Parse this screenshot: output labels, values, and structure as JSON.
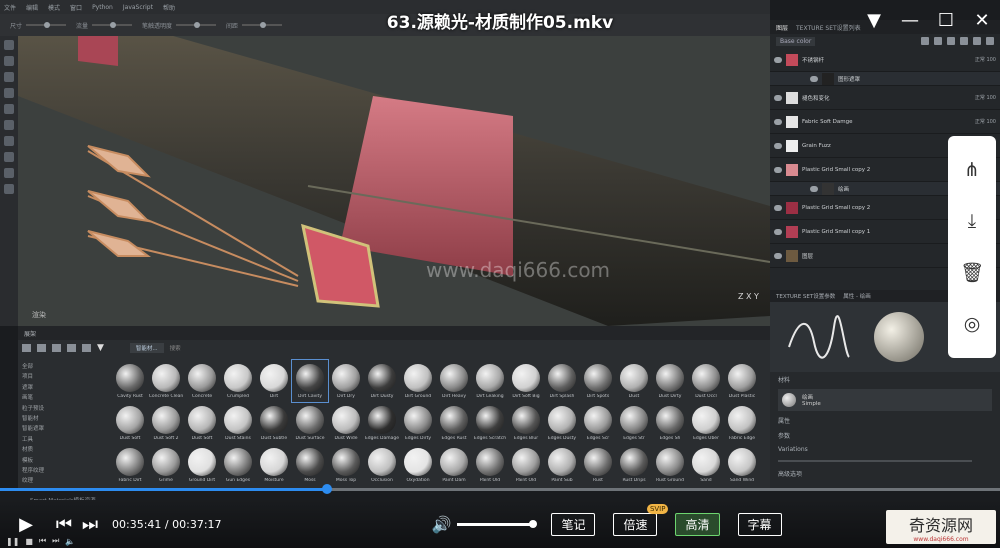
{
  "video": {
    "title": "63.源赖光-材质制作05.mkv",
    "current_time": "00:35:41",
    "time_separator": "/",
    "total_time": "00:37:17",
    "progress_fraction": 0.957,
    "volume_fraction": 1.0
  },
  "player": {
    "notes_label": "笔记",
    "speed_label": "倍速",
    "svip_badge": "SVIP",
    "quality_label": "高清",
    "subtitle_label": "字幕"
  },
  "brand": {
    "name": "奇资源网",
    "url": "www.daqi666.com"
  },
  "watermark": "www.daqi666.com",
  "app": {
    "menu": [
      "文件",
      "编辑",
      "模式",
      "窗口",
      "Python",
      "JavaScript",
      "帮助"
    ],
    "tool_labels": [
      "尺寸",
      "流量",
      "笔触透明度",
      "间距"
    ]
  },
  "viewport": {
    "label": "渲染",
    "axis": "Z X Y"
  },
  "layers": {
    "tabs": [
      "图层",
      "TEXTURE SET设置列表"
    ],
    "blend_mode": "Base color",
    "rows": [
      {
        "name": "不锈钢杆",
        "blend": "正常 100",
        "thumb": "#c34a5a",
        "sub": false
      },
      {
        "name": "图形遮罩",
        "blend": "",
        "thumb": "#222",
        "sub": true
      },
      {
        "name": "褪色和变化",
        "blend": "正常 100",
        "thumb": "#dddddd",
        "sub": false
      },
      {
        "name": "Fabric Soft Damge",
        "blend": "正常 100",
        "thumb": "#e6e6e6",
        "sub": false
      },
      {
        "name": "Grain Fuzz",
        "blend": "正常 100",
        "thumb": "#eeeeee",
        "sub": false
      },
      {
        "name": "Plastic Grid Small copy 2",
        "blend": "正常 100",
        "thumb": "#d98a90",
        "sub": false
      },
      {
        "name": "绘画",
        "blend": "叠加",
        "thumb": "#333",
        "sub": true
      },
      {
        "name": "Plastic Grid Small copy 2",
        "blend": "正常 100",
        "thumb": "#9c2f44",
        "sub": false
      },
      {
        "name": "Plastic Grid Small copy 1",
        "blend": "正常 100",
        "thumb": "#b23e54",
        "sub": false
      },
      {
        "name": "图层",
        "blend": "正常 100",
        "thumb": "#6d5a40",
        "sub": false
      }
    ]
  },
  "properties": {
    "tabs": [
      "TEXTURE SET设置参数",
      "属性 - 绘画"
    ],
    "section_material": "材料",
    "material_name": "绘画",
    "material_sub": "Simple",
    "section_attr": "属性",
    "section_params": "参数",
    "param_name": "Variations",
    "footer": "高级选项"
  },
  "shelf": {
    "title": "展架",
    "search_placeholder": "智能材...",
    "filter_tag": "搜索",
    "categories": [
      "全部",
      "项目",
      "遮罩",
      "画笔",
      "粒子预设",
      "智能材",
      "智能遮罩",
      "工具",
      "材质",
      "模板",
      "程序纹理",
      "纹理"
    ],
    "footer_label": "Smart Materials模板资源",
    "materials": [
      {
        "name": "Cavity Rust",
        "color": "#6a6a6a"
      },
      {
        "name": "Concrete Clean",
        "color": "#b8b8b8"
      },
      {
        "name": "Concrete",
        "color": "#9a9a9a"
      },
      {
        "name": "Crumpled",
        "color": "#c8c8c8"
      },
      {
        "name": "Dirt",
        "color": "#d8d8d8"
      },
      {
        "name": "Dirt Cavity",
        "color": "#444444"
      },
      {
        "name": "Dirt Dry",
        "color": "#a0a0a0"
      },
      {
        "name": "Dirt Dusty",
        "color": "#3c3c3c"
      },
      {
        "name": "Dirt Ground",
        "color": "#c0c0c0"
      },
      {
        "name": "Dirt Heavy",
        "color": "#8a8a8a"
      },
      {
        "name": "Dirt Leaking",
        "color": "#a8a8a8"
      },
      {
        "name": "Dirt Soft Big",
        "color": "#d0d0d0"
      },
      {
        "name": "Dirt Splash",
        "color": "#606060"
      },
      {
        "name": "Dirt Spots",
        "color": "#707070"
      },
      {
        "name": "Dust",
        "color": "#b0b0b0"
      },
      {
        "name": "Dust Dirty",
        "color": "#7a7a7a"
      },
      {
        "name": "Dust Occl",
        "color": "#8e8e8e"
      },
      {
        "name": "Dust Plastic",
        "color": "#9e9e9e"
      },
      {
        "name": "Dust Soft",
        "color": "#a4a4a4"
      },
      {
        "name": "Dust Soft 2",
        "color": "#9c9c9c"
      },
      {
        "name": "Dust Soft",
        "color": "#b6b6b6"
      },
      {
        "name": "Dust Stains",
        "color": "#c4c4c4"
      },
      {
        "name": "Dust Subtle",
        "color": "#3a3a3a"
      },
      {
        "name": "Dust Surface",
        "color": "#6c6c6c"
      },
      {
        "name": "Dust Wide",
        "color": "#bcbcbc"
      },
      {
        "name": "Edges Damage",
        "color": "#2e2e2e"
      },
      {
        "name": "Edges Dirty",
        "color": "#8c8c8c"
      },
      {
        "name": "Edges Rust",
        "color": "#5e5e5e"
      },
      {
        "name": "Edges Scratch",
        "color": "#3e3e3e"
      },
      {
        "name": "Edges Blur",
        "color": "#545454"
      },
      {
        "name": "Edges Dusty",
        "color": "#b2b2b2"
      },
      {
        "name": "Edges Scr",
        "color": "#9a9a9a"
      },
      {
        "name": "Edges Str",
        "color": "#868686"
      },
      {
        "name": "Edges Sh",
        "color": "#6a6a6a"
      },
      {
        "name": "Edges Uber",
        "color": "#cfcfcf"
      },
      {
        "name": "Fabric Edge",
        "color": "#c2c2c2"
      },
      {
        "name": "Fabric Dirt",
        "color": "#7c7c7c"
      },
      {
        "name": "Grime",
        "color": "#9a9a9a"
      },
      {
        "name": "Ground Dirt",
        "color": "#e0e0e0"
      },
      {
        "name": "Gun Edges",
        "color": "#7a7a7a"
      },
      {
        "name": "Moisture",
        "color": "#d6d6d6"
      },
      {
        "name": "Moss",
        "color": "#4c4c4c"
      },
      {
        "name": "Moss Top",
        "color": "#5a5a5a"
      },
      {
        "name": "Occlusion",
        "color": "#c0c0c0"
      },
      {
        "name": "Oxydation",
        "color": "#e4e4e4"
      },
      {
        "name": "Paint Dam",
        "color": "#a8a8a8"
      },
      {
        "name": "Paint Old",
        "color": "#727272"
      },
      {
        "name": "Paint Old",
        "color": "#9e9e9e"
      },
      {
        "name": "Paint Sub",
        "color": "#b0b0b0"
      },
      {
        "name": "Rust",
        "color": "#6e6e6e"
      },
      {
        "name": "Rust Drips",
        "color": "#5a5a5a"
      },
      {
        "name": "Rust Ground",
        "color": "#8a8a8a"
      },
      {
        "name": "Sand",
        "color": "#d8d8d8"
      },
      {
        "name": "Sand Wind",
        "color": "#c6c6c6"
      }
    ]
  }
}
